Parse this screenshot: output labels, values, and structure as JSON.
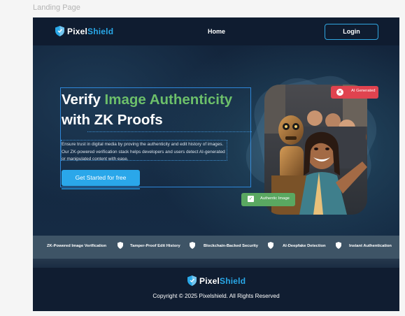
{
  "canvas": {
    "frame_label": "Landing Page"
  },
  "brand": {
    "name_part1": "Pixel",
    "name_part2": "Shield",
    "accent": "#29a8e8"
  },
  "nav": {
    "home_label": "Home",
    "login_label": "Login"
  },
  "hero": {
    "title_part1": "Verify ",
    "title_accent": "Image Authenticity",
    "title_part2": "with ZK Proofs",
    "description": "Ensure trust in digital media by proving the authenticity and edit history of images. Our ZK-powered verification stack helps developers and users detect AI-generated or manipulated content with ease.",
    "cta_label": "Get Started for free",
    "badge_ai_label": "AI Generated",
    "badge_authentic_label": "Authentic Image"
  },
  "features": [
    {
      "label": "ZK-Powered Image Verification"
    },
    {
      "label": "Tamper-Proof Edit History"
    },
    {
      "label": "Blockchain-Backed Security"
    },
    {
      "label": "AI-Deepfake Detection"
    },
    {
      "label": "Instant Authentication"
    }
  ],
  "footer": {
    "copyright": "Copyright © 2025 Pixelshield. All Rights Reserved"
  },
  "colors": {
    "background": "#101e33",
    "accent_green": "#6cbf6a",
    "cta_blue": "#2aa7ea",
    "badge_red": "#e0434f",
    "badge_green": "#5aa861"
  }
}
